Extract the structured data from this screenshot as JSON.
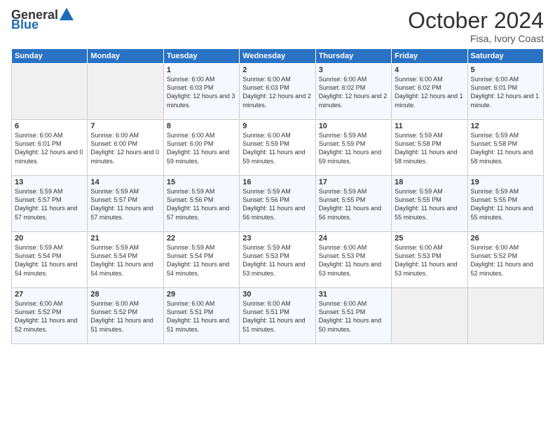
{
  "header": {
    "logo_general": "General",
    "logo_blue": "Blue",
    "month": "October 2024",
    "location": "Fisa, Ivory Coast"
  },
  "weekdays": [
    "Sunday",
    "Monday",
    "Tuesday",
    "Wednesday",
    "Thursday",
    "Friday",
    "Saturday"
  ],
  "weeks": [
    [
      {
        "day": "",
        "empty": true
      },
      {
        "day": "",
        "empty": true
      },
      {
        "day": "1",
        "sunrise": "6:00 AM",
        "sunset": "6:03 PM",
        "daylight": "12 hours and 3 minutes."
      },
      {
        "day": "2",
        "sunrise": "6:00 AM",
        "sunset": "6:03 PM",
        "daylight": "12 hours and 2 minutes."
      },
      {
        "day": "3",
        "sunrise": "6:00 AM",
        "sunset": "6:02 PM",
        "daylight": "12 hours and 2 minutes."
      },
      {
        "day": "4",
        "sunrise": "6:00 AM",
        "sunset": "6:02 PM",
        "daylight": "12 hours and 1 minute."
      },
      {
        "day": "5",
        "sunrise": "6:00 AM",
        "sunset": "6:01 PM",
        "daylight": "12 hours and 1 minute."
      }
    ],
    [
      {
        "day": "6",
        "sunrise": "6:00 AM",
        "sunset": "6:01 PM",
        "daylight": "12 hours and 0 minutes."
      },
      {
        "day": "7",
        "sunrise": "6:00 AM",
        "sunset": "6:00 PM",
        "daylight": "12 hours and 0 minutes."
      },
      {
        "day": "8",
        "sunrise": "6:00 AM",
        "sunset": "6:00 PM",
        "daylight": "11 hours and 59 minutes."
      },
      {
        "day": "9",
        "sunrise": "6:00 AM",
        "sunset": "5:59 PM",
        "daylight": "11 hours and 59 minutes."
      },
      {
        "day": "10",
        "sunrise": "5:59 AM",
        "sunset": "5:59 PM",
        "daylight": "11 hours and 59 minutes."
      },
      {
        "day": "11",
        "sunrise": "5:59 AM",
        "sunset": "5:58 PM",
        "daylight": "11 hours and 58 minutes."
      },
      {
        "day": "12",
        "sunrise": "5:59 AM",
        "sunset": "5:58 PM",
        "daylight": "11 hours and 58 minutes."
      }
    ],
    [
      {
        "day": "13",
        "sunrise": "5:59 AM",
        "sunset": "5:57 PM",
        "daylight": "11 hours and 57 minutes."
      },
      {
        "day": "14",
        "sunrise": "5:59 AM",
        "sunset": "5:57 PM",
        "daylight": "11 hours and 57 minutes."
      },
      {
        "day": "15",
        "sunrise": "5:59 AM",
        "sunset": "5:56 PM",
        "daylight": "11 hours and 57 minutes."
      },
      {
        "day": "16",
        "sunrise": "5:59 AM",
        "sunset": "5:56 PM",
        "daylight": "11 hours and 56 minutes."
      },
      {
        "day": "17",
        "sunrise": "5:59 AM",
        "sunset": "5:55 PM",
        "daylight": "11 hours and 56 minutes."
      },
      {
        "day": "18",
        "sunrise": "5:59 AM",
        "sunset": "5:55 PM",
        "daylight": "11 hours and 55 minutes."
      },
      {
        "day": "19",
        "sunrise": "5:59 AM",
        "sunset": "5:55 PM",
        "daylight": "11 hours and 55 minutes."
      }
    ],
    [
      {
        "day": "20",
        "sunrise": "5:59 AM",
        "sunset": "5:54 PM",
        "daylight": "11 hours and 54 minutes."
      },
      {
        "day": "21",
        "sunrise": "5:59 AM",
        "sunset": "5:54 PM",
        "daylight": "11 hours and 54 minutes."
      },
      {
        "day": "22",
        "sunrise": "5:59 AM",
        "sunset": "5:54 PM",
        "daylight": "11 hours and 54 minutes."
      },
      {
        "day": "23",
        "sunrise": "5:59 AM",
        "sunset": "5:53 PM",
        "daylight": "11 hours and 53 minutes."
      },
      {
        "day": "24",
        "sunrise": "6:00 AM",
        "sunset": "5:53 PM",
        "daylight": "11 hours and 53 minutes."
      },
      {
        "day": "25",
        "sunrise": "6:00 AM",
        "sunset": "5:53 PM",
        "daylight": "11 hours and 53 minutes."
      },
      {
        "day": "26",
        "sunrise": "6:00 AM",
        "sunset": "5:52 PM",
        "daylight": "11 hours and 52 minutes."
      }
    ],
    [
      {
        "day": "27",
        "sunrise": "6:00 AM",
        "sunset": "5:52 PM",
        "daylight": "11 hours and 52 minutes."
      },
      {
        "day": "28",
        "sunrise": "6:00 AM",
        "sunset": "5:52 PM",
        "daylight": "11 hours and 51 minutes."
      },
      {
        "day": "29",
        "sunrise": "6:00 AM",
        "sunset": "5:51 PM",
        "daylight": "11 hours and 51 minutes."
      },
      {
        "day": "30",
        "sunrise": "6:00 AM",
        "sunset": "5:51 PM",
        "daylight": "11 hours and 51 minutes."
      },
      {
        "day": "31",
        "sunrise": "6:00 AM",
        "sunset": "5:51 PM",
        "daylight": "11 hours and 50 minutes."
      },
      {
        "day": "",
        "empty": true
      },
      {
        "day": "",
        "empty": true
      }
    ]
  ]
}
